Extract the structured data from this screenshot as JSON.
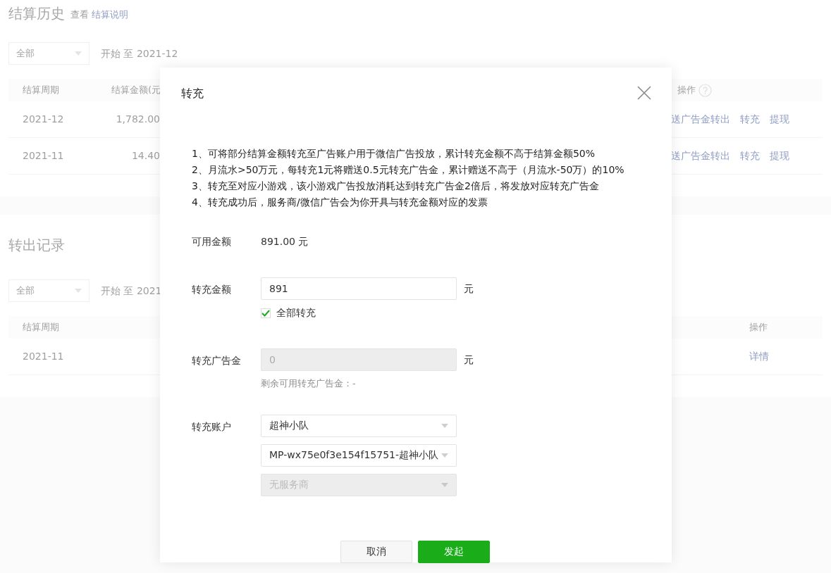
{
  "settlement_history": {
    "title": "结算历史",
    "view_label": "查看",
    "view_link": "结算说明",
    "filter": {
      "value": "全部"
    },
    "date_range": "开始 至 2021-12",
    "columns": [
      "结算周期",
      "结算金额(元"
    ],
    "action_column": "操作",
    "rows": [
      {
        "period": "2021-12",
        "amount": "1,782.00",
        "actions": [
          "送广告金转出",
          "转充",
          "提现"
        ]
      },
      {
        "period": "2021-11",
        "amount": "14.40",
        "actions": [
          "送广告金转出",
          "转充",
          "提现"
        ]
      }
    ]
  },
  "transfer_records": {
    "title": "转出记录",
    "filter": {
      "value": "全部"
    },
    "date_range": "开始 至 2021",
    "columns": [
      "结算周期"
    ],
    "action_column": "操作",
    "rows": [
      {
        "period": "2021-11",
        "actions": [
          "详情"
        ]
      }
    ]
  },
  "dialog": {
    "title": "转充",
    "notes": [
      "1、可将部分结算金额转充至广告账户用于微信广告投放，累计转充金额不高于结算金额50%",
      "2、月流水>50万元，每转充1元将赠送0.5元转充广告金，累计赠送不高于（月流水-50万）的10%",
      "3、转充至对应小游戏，该小游戏广告投放消耗达到转充广告金2倍后，将发放对应转充广告金",
      "4、转充成功后，服务商/微信广告会为你开具与转充金额对应的发票"
    ],
    "available": {
      "label": "可用金额",
      "value": "891.00 元"
    },
    "amount": {
      "label": "转充金额",
      "value": "891",
      "unit": "元",
      "disabled": false
    },
    "transfer_all": {
      "label": "全部转充",
      "checked": true
    },
    "ad_credit": {
      "label": "转充广告金",
      "value": "0",
      "unit": "元",
      "disabled": true,
      "hint": "剩余可用转充广告金：-"
    },
    "account": {
      "label": "转充账户",
      "selects": [
        {
          "value": "超神小队",
          "disabled": false
        },
        {
          "value": "MP-wx75e0f3e154f15751-超神小队",
          "disabled": false
        },
        {
          "value": "无服务商",
          "disabled": true
        }
      ]
    },
    "buttons": [
      {
        "label": "取消",
        "kind": "secondary"
      },
      {
        "label": "发起",
        "kind": "primary"
      }
    ]
  }
}
